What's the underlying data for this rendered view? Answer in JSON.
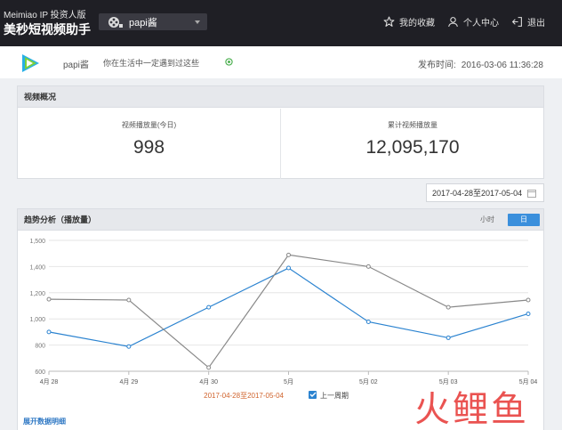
{
  "header": {
    "brand_line1": "Meimiao IP 投资人版",
    "brand_line2": "美秒短视频助手",
    "account_name": "papi酱",
    "nav": {
      "favorites": "我的收藏",
      "profile": "个人中心",
      "logout": "退出"
    }
  },
  "video": {
    "author": "papi酱",
    "title": "你在生活中一定遇到过这些",
    "published_label": "发布时间:",
    "published_value": "2016-03-06 11:36:28"
  },
  "overview": {
    "title": "视频概况",
    "today_label": "视频播放量(今日)",
    "today_value": "998",
    "total_label": "累计视频播放量",
    "total_value": "12,095,170"
  },
  "date_range": "2017-04-28至2017-05-04",
  "trend": {
    "title": "趋势分析（播放量）",
    "granularity": {
      "hour": "小时",
      "day": "日"
    },
    "legend_current": "2017-04-28至2017-05-04",
    "legend_previous": "上一周期",
    "expand_link": "展开数据明细"
  },
  "chart_data": {
    "type": "line",
    "categories": [
      "4月 28",
      "4月 29",
      "4月 30",
      "5月",
      "5月 02",
      "5月 03",
      "5月 04"
    ],
    "ylim": [
      600,
      1500
    ],
    "yticks": [
      "1,500",
      "1,400",
      "1,200",
      "1,000",
      "800",
      "600"
    ],
    "series": [
      {
        "name": "2017-04-28至2017-05-04",
        "color": "#2b83d0",
        "values": [
          870,
          770,
          1040,
          1310,
          940,
          830,
          995
        ]
      },
      {
        "name": "上一周期",
        "color": "#888888",
        "values": [
          1095,
          1090,
          625,
          1400,
          1320,
          1040,
          1090
        ]
      }
    ]
  },
  "watermark": "火鲤鱼",
  "colors": {
    "topbar": "#1f1f25",
    "accent": "#3a8fdc",
    "green": "#4caf50"
  }
}
